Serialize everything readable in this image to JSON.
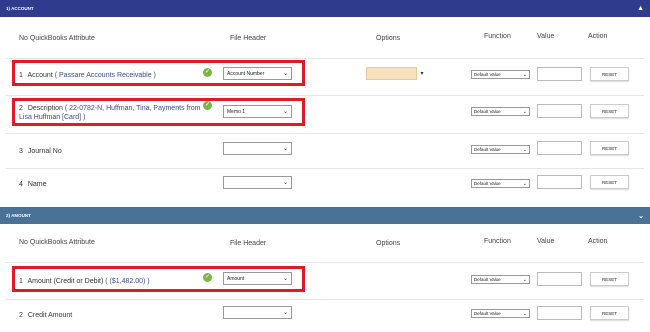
{
  "sections": [
    {
      "title": "1) ACCOUNT",
      "headers": {
        "no_attr": "No  QuickBooks Attribute",
        "file_header": "File Header",
        "options": "Options",
        "function": "Function",
        "value": "Value",
        "action": "Action"
      },
      "rows": [
        {
          "no": "1",
          "label": "Account",
          "detail": "( Passare Accounts Receivable )",
          "file_header": "Account Number",
          "function": "Default Value",
          "reset": "RESET"
        },
        {
          "no": "2",
          "label": "Description",
          "detail": "( 22-0782-N, Huffman, Tina, Payments from Lisa Huffman [Card] )",
          "file_header": "Memo 1",
          "function": "Default Value",
          "reset": "RESET"
        },
        {
          "no": "3",
          "label": "Journal No",
          "detail": "",
          "file_header": "",
          "function": "Default Value",
          "reset": "RESET"
        },
        {
          "no": "4",
          "label": "Name",
          "detail": "",
          "file_header": "",
          "function": "Default Value",
          "reset": "RESET"
        }
      ]
    },
    {
      "title": "2) AMOUNT",
      "headers": {
        "no_attr": "No  QuickBooks Attribute",
        "file_header": "File Header",
        "options": "Options",
        "function": "Function",
        "value": "Value",
        "action": "Action"
      },
      "rows": [
        {
          "no": "1",
          "label": "Amount (Credit or Debit)",
          "detail": "( ($1,482.00) )",
          "file_header": "Amount",
          "function": "Default Value",
          "reset": "RESET"
        },
        {
          "no": "2",
          "label": "Credit Amount",
          "detail": "",
          "file_header": "",
          "function": "Default Value",
          "reset": "RESET"
        }
      ]
    }
  ],
  "colors": {
    "account_bar": "#2f3b8c",
    "amount_bar": "#4a7196",
    "highlight": "#e01b24",
    "check": "#7ab648"
  }
}
